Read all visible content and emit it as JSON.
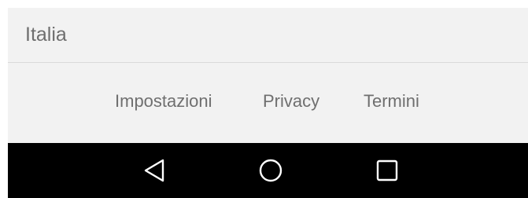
{
  "footer": {
    "region": "Italia",
    "links": {
      "settings": "Impostazioni",
      "privacy": "Privacy",
      "terms": "Termini"
    }
  },
  "navbar": {
    "back_icon": "back-triangle-icon",
    "home_icon": "home-circle-icon",
    "recents_icon": "recents-square-icon"
  },
  "colors": {
    "footer_bg": "#f2f2f2",
    "text": "#6f6f6f",
    "divider": "#dadada",
    "navbar_bg": "#000000",
    "nav_icon": "#ffffff"
  }
}
